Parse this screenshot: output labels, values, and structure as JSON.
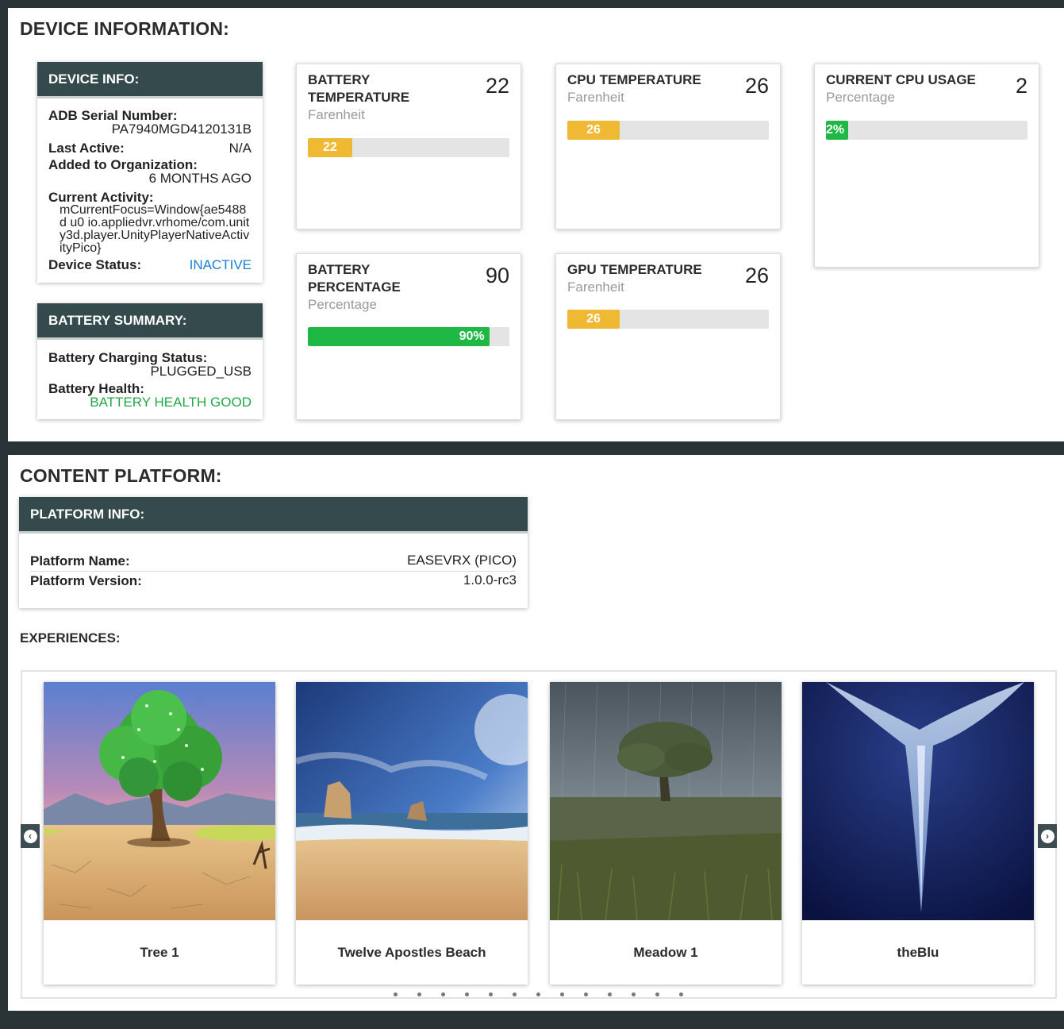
{
  "device_section": {
    "title": "DEVICE INFORMATION:",
    "device_info": {
      "header": "DEVICE INFO:",
      "adb_label": "ADB Serial Number:",
      "adb_value": "PA7940MGD4120131B",
      "last_active_label": "Last Active:",
      "last_active_value": "N/A",
      "added_label": "Added to Organization:",
      "added_value": "6 MONTHS AGO",
      "activity_label": "Current Activity:",
      "activity_value": "mCurrentFocus=Window{ae5488d u0 io.appliedvr.vrhome/com.unity3d.player.UnityPlayerNativeActivityPico}",
      "status_label": "Device Status:",
      "status_value": "INACTIVE"
    },
    "battery_summary": {
      "header": "BATTERY SUMMARY:",
      "charging_label": "Battery Charging Status:",
      "charging_value": "PLUGGED_USB",
      "health_label": "Battery Health:",
      "health_value": "BATTERY HEALTH GOOD"
    },
    "metrics": [
      {
        "title": "BATTERY TEMPERATURE",
        "unit": "Farenheit",
        "value": "22",
        "bar_label": "22",
        "percent": 22
      },
      {
        "title": "CPU TEMPERATURE",
        "unit": "Farenheit",
        "value": "26",
        "bar_label": "26",
        "percent": 26
      },
      {
        "title": "CURRENT CPU USAGE",
        "unit": "Percentage",
        "value": "2",
        "bar_label": "2%",
        "percent": 2
      },
      {
        "title": "BATTERY PERCENTAGE",
        "unit": "Percentage",
        "value": "90",
        "bar_label": "90%",
        "percent": 90
      },
      {
        "title": "GPU TEMPERATURE",
        "unit": "Farenheit",
        "value": "26",
        "bar_label": "26",
        "percent": 26
      }
    ]
  },
  "content_section": {
    "title": "CONTENT PLATFORM:",
    "platform_info": {
      "header": "PLATFORM INFO:",
      "name_label": "Platform Name:",
      "name_value": "EASEVRX (PICO)",
      "version_label": "Platform Version:",
      "version_value": "1.0.0-rc3"
    },
    "experiences_title": "EXPERIENCES:",
    "experiences": [
      {
        "name": "Tree 1"
      },
      {
        "name": "Twelve Apostles Beach"
      },
      {
        "name": "Meadow 1"
      },
      {
        "name": "theBlu"
      }
    ],
    "carousel_dot_count": 13
  },
  "colors": {
    "header_bg": "#354a4d",
    "page_bg": "#2a3436",
    "status_inactive": "#1a7fd4",
    "health_good": "#22a845",
    "bar_yellow": "#f0b933",
    "bar_green": "#1fb845"
  },
  "icons": {
    "carousel_prev": "chevron-left-circle-icon",
    "carousel_next": "chevron-right-circle-icon"
  }
}
